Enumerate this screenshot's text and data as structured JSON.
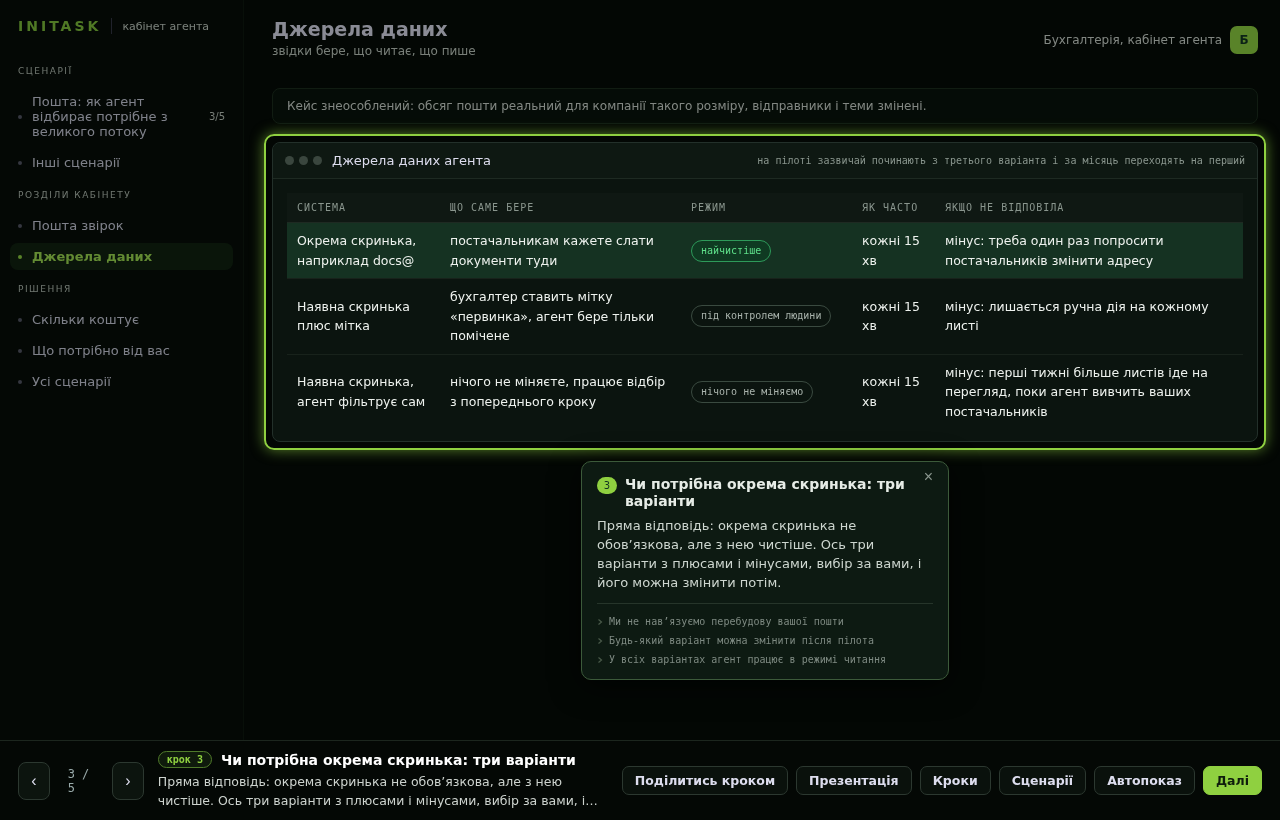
{
  "brand": {
    "logo": "INITASK",
    "subtitle": "кабінет агента"
  },
  "sidebar": {
    "sections": [
      {
        "title": "СЦЕНАРІЇ",
        "items": [
          {
            "label": "Пошта: як агент відбирає потрібне з великого потоку",
            "count": "3/5",
            "selected": false
          },
          {
            "label": "Інші сценарії",
            "selected": false
          }
        ]
      },
      {
        "title": "РОЗДІЛИ КАБІНЕТУ",
        "items": [
          {
            "label": "Пошта звірок",
            "selected": false
          },
          {
            "label": "Джерела даних",
            "selected": true
          }
        ]
      },
      {
        "title": "РІШЕННЯ",
        "items": [
          {
            "label": "Скільки коштує",
            "selected": false
          },
          {
            "label": "Що потрібно від вас",
            "selected": false
          },
          {
            "label": "Усі сценарії",
            "selected": false
          }
        ]
      }
    ]
  },
  "header": {
    "title": "Джерела даних",
    "subtitle": "звідки бере, що читає, що пише",
    "account": "Бухгалтерія, кабінет агента",
    "avatar": "Б"
  },
  "notice": "Кейс знеособлений: обсяг пошти реальний для компанії такого розміру, відправники і теми змінені.",
  "panel": {
    "title": "Джерела даних агента",
    "note": "на пілоті зазвичай починають з третього варіанта і за місяць переходять на перший",
    "columns": [
      "СИСТЕМА",
      "ЩО САМЕ БЕРЕ",
      "РЕЖИМ",
      "ЯК ЧАСТО",
      "ЯКЩО НЕ ВІДПОВІЛА"
    ],
    "rows": [
      {
        "selected": true,
        "system": "Окрема скринька, наприклад docs@",
        "takes": "постачальникам кажете слати документи туди",
        "mode": {
          "label": "найчистіше",
          "kind": "best"
        },
        "frequency": "кожні 15 хв",
        "downside": "мінус: треба один раз попросити постачальників змінити адресу"
      },
      {
        "selected": false,
        "system": "Наявна скринька плюс мітка",
        "takes": "бухгалтер ставить мітку «первинка», агент бере тільки помічене",
        "mode": {
          "label": "під контролем людини",
          "kind": "neutral"
        },
        "frequency": "кожні 15 хв",
        "downside": "мінус: лишається ручна дія на кожному листі"
      },
      {
        "selected": false,
        "system": "Наявна скринька, агент фільтрує сам",
        "takes": "нічого не міняєте, працює відбір з попереднього кроку",
        "mode": {
          "label": "нічого не міняємо",
          "kind": "neutral"
        },
        "frequency": "кожні 15 хв",
        "downside": "мінус: перші тижні більше листів іде на перегляд, поки агент вивчить ваших постачальників"
      }
    ]
  },
  "tooltip": {
    "step": "3",
    "title": "Чи потрібна окрема скринька: три варіанти",
    "body": "Пряма відповідь: окрема скринька не обов’язкова, але з нею чистіше. Ось три варіанти з плюсами і мінусами, вибір за вами, і його можна змінити потім.",
    "close": "×",
    "points": [
      "Ми не нав’язуємо перебудову вашої пошти",
      "Будь-який варіант можна змінити після пілота",
      "У всіх варіантах агент працює в режимі читання"
    ]
  },
  "footer": {
    "prev": "‹",
    "position": "3 / 5",
    "next": "›",
    "badge": "крок 3",
    "title": "Чи потрібна окрема скринька: три варіанти",
    "text": "Пряма відповідь: окрема скринька не обов’язкова, але з нею чистіше. Ось три варіанти з плюсами і мінусами, вибір за вами, і…",
    "buttons": [
      {
        "label": "Поділитись кроком",
        "primary": false
      },
      {
        "label": "Презентація",
        "primary": false
      },
      {
        "label": "Кроки",
        "primary": false
      },
      {
        "label": "Сценарії",
        "primary": false
      },
      {
        "label": "Автопоказ",
        "primary": false
      },
      {
        "label": "Далі",
        "primary": true
      }
    ]
  }
}
